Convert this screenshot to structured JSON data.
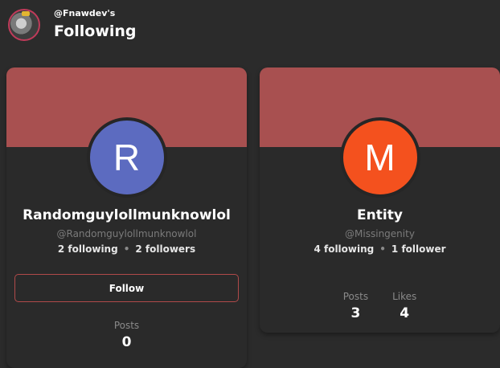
{
  "colors": {
    "background": "#2b2b2b",
    "banner": "#a85050",
    "accent_border": "#b04a4a",
    "avatar_r": "#5c6bc0",
    "avatar_m": "#f4511e"
  },
  "header": {
    "owner": "@Fnawdev's",
    "title": "Following",
    "avatar_icon": "user-avatar-image"
  },
  "cards": [
    {
      "initial": "R",
      "name": "Randomguylollmunknowlol",
      "handle": "@Randomguylollmunknowlol",
      "following": "2 following",
      "separator": "•",
      "followers": "2 followers",
      "follow_label": "Follow",
      "stats": [
        {
          "label": "Posts",
          "value": "0"
        }
      ]
    },
    {
      "initial": "M",
      "name": "Entity",
      "handle": "@Missingenity",
      "following": "4 following",
      "separator": "•",
      "followers": "1 follower",
      "stats": [
        {
          "label": "Posts",
          "value": "3"
        },
        {
          "label": "Likes",
          "value": "4"
        }
      ]
    }
  ]
}
